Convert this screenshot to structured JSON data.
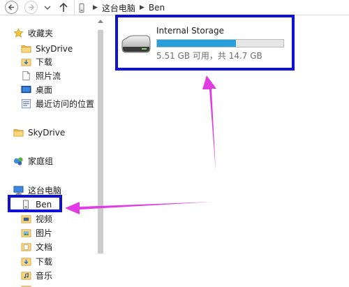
{
  "address": {
    "crumbs": [
      "这台电脑",
      "Ben"
    ],
    "separator": "▶"
  },
  "sidebar": {
    "favorites": {
      "label": "收藏夹",
      "items": [
        {
          "label": "SkyDrive",
          "icon": "folder-icon"
        },
        {
          "label": "下载",
          "icon": "downloads-icon"
        },
        {
          "label": "照片流",
          "icon": "photostream-icon"
        },
        {
          "label": "桌面",
          "icon": "desktop-icon"
        },
        {
          "label": "最近访问的位置",
          "icon": "recent-places-icon"
        }
      ]
    },
    "skydrive": {
      "label": "SkyDrive",
      "icon": "folder-icon"
    },
    "homegroup": {
      "label": "家庭组",
      "icon": "homegroup-icon"
    },
    "this_pc": {
      "label": "这台电脑",
      "items": [
        {
          "label": "Ben",
          "icon": "drive-icon"
        },
        {
          "label": "视频",
          "icon": "videos-folder-icon"
        },
        {
          "label": "图片",
          "icon": "pictures-folder-icon"
        },
        {
          "label": "文档",
          "icon": "documents-folder-icon"
        },
        {
          "label": "下载",
          "icon": "downloads-folder-icon"
        },
        {
          "label": "音乐",
          "icon": "music-folder-icon"
        }
      ]
    }
  },
  "drive": {
    "name": "Internal Storage",
    "info": "5.51 GB 可用，共 14.7 GB",
    "used_fraction": 0.625,
    "bar_color": "#26a0da"
  },
  "annotation": {
    "box_color": "#0f12d6",
    "arrow_color": "#e13ce4"
  }
}
